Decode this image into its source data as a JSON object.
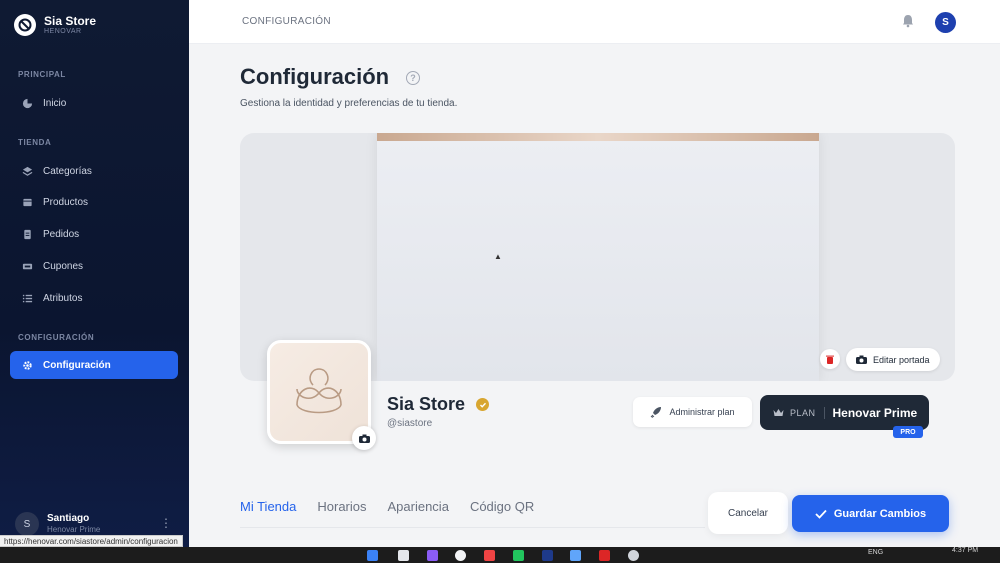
{
  "sidebar": {
    "brand_name": "Sia Store",
    "brand_sub": "HENOVAR",
    "sections": [
      {
        "title": "PRINCIPAL"
      },
      {
        "title": "TIENDA"
      },
      {
        "title": "CONFIGURACIÓN"
      }
    ],
    "items": [
      {
        "label": "Inicio",
        "icon": "home-icon"
      },
      {
        "label": "Categorías",
        "icon": "layers-icon"
      },
      {
        "label": "Productos",
        "icon": "box-icon"
      },
      {
        "label": "Pedidos",
        "icon": "clipboard-icon"
      },
      {
        "label": "Cupones",
        "icon": "ticket-icon"
      },
      {
        "label": "Atributos",
        "icon": "list-icon"
      },
      {
        "label": "Configuración",
        "icon": "gear-icon",
        "active": true
      }
    ],
    "user": {
      "initial": "S",
      "name": "Santiago",
      "plan": "Henovar Prime"
    },
    "status_url": "https://henovar.com/siastore/admin/configuracion"
  },
  "topbar": {
    "breadcrumb": "CONFIGURACIÓN",
    "avatar_initial": "S"
  },
  "page": {
    "title": "Configuración",
    "subtitle": "Gestiona la identidad y preferencias de tu tienda."
  },
  "cover": {
    "edit_label": "Editar portada"
  },
  "store": {
    "name": "Sia Store",
    "handle": "@siastore"
  },
  "plan": {
    "admin_label": "Administrar plan",
    "plan_label": "PLAN",
    "plan_name": "Henovar Prime",
    "badge": "PRO"
  },
  "tabs": [
    {
      "label": "Mi Tienda",
      "active": true
    },
    {
      "label": "Horarios"
    },
    {
      "label": "Apariencia"
    },
    {
      "label": "Código QR"
    }
  ],
  "actions": {
    "cancel_label": "Cancelar",
    "save_label": "Guardar Cambios"
  },
  "taskbar": {
    "lang": "ENG",
    "time": "4:37 PM"
  },
  "colors": {
    "accent": "#2563eb",
    "sidebar_bg": "#0f1a33",
    "verified": "#d8a630"
  }
}
